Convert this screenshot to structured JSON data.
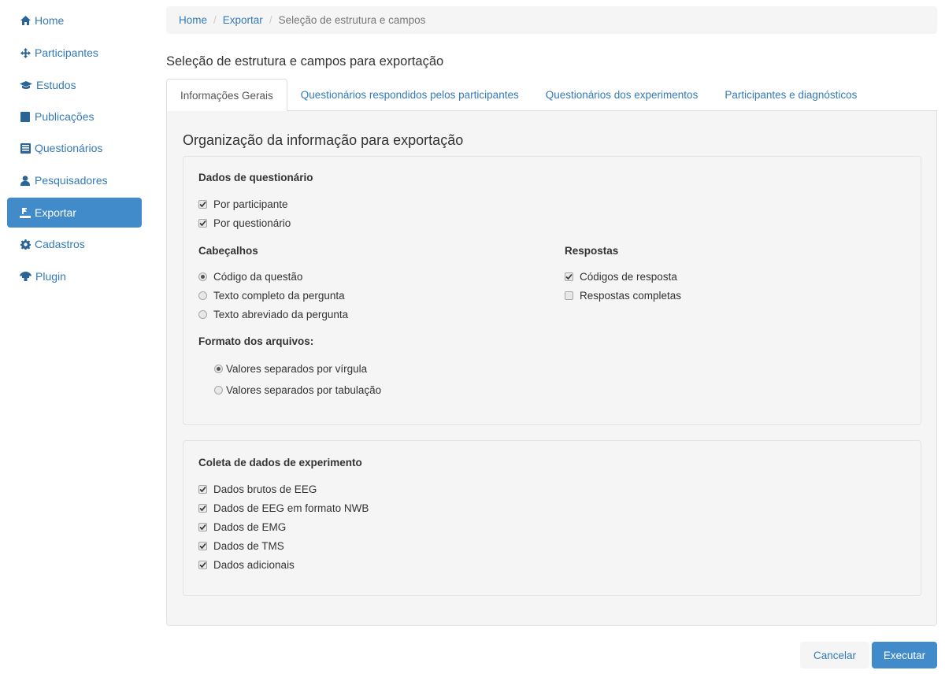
{
  "sidebar": {
    "items": [
      {
        "label": "Home",
        "icon": "home-icon",
        "active": false
      },
      {
        "label": "Participantes",
        "icon": "move-icon",
        "active": false
      },
      {
        "label": "Estudos",
        "icon": "graduation-cap-icon",
        "active": false
      },
      {
        "label": "Publicações",
        "icon": "book-icon",
        "active": false
      },
      {
        "label": "Questionários",
        "icon": "list-alt-icon",
        "active": false
      },
      {
        "label": "Pesquisadores",
        "icon": "user-icon",
        "active": false
      },
      {
        "label": "Exportar",
        "icon": "export-icon",
        "active": true
      },
      {
        "label": "Cadastros",
        "icon": "gear-icon",
        "active": false
      },
      {
        "label": "Plugin",
        "icon": "plugin-icon",
        "active": false
      }
    ]
  },
  "breadcrumb": {
    "home": "Home",
    "exportar": "Exportar",
    "current": "Seleção de estrutura e campos",
    "separator": "/"
  },
  "page_title": "Seleção de estrutura e campos para exportação",
  "tabs": [
    {
      "label": "Informações Gerais",
      "active": true
    },
    {
      "label": "Questionários respondidos pelos participantes",
      "active": false
    },
    {
      "label": "Questionários dos experimentos",
      "active": false
    },
    {
      "label": "Participantes e diagnósticos",
      "active": false
    }
  ],
  "section_title": "Organização da informação para exportação",
  "questionnaire": {
    "title": "Dados de questionário",
    "options": [
      {
        "label": "Por participante",
        "checked": true
      },
      {
        "label": "Por questionário",
        "checked": true
      }
    ]
  },
  "headers": {
    "title": "Cabeçalhos",
    "options": [
      {
        "label": "Código da questão",
        "checked": true
      },
      {
        "label": "Texto completo da pergunta",
        "checked": false
      },
      {
        "label": "Texto abreviado da pergunta",
        "checked": false
      }
    ]
  },
  "answers": {
    "title": "Respostas",
    "options": [
      {
        "label": "Códigos de resposta",
        "checked": true
      },
      {
        "label": "Respostas completas",
        "checked": false
      }
    ]
  },
  "file_format": {
    "title": "Formato dos arquivos:",
    "options": [
      {
        "label": "Valores separados por vírgula",
        "checked": true
      },
      {
        "label": "Valores separados por tabulação",
        "checked": false
      }
    ]
  },
  "experiment": {
    "title": "Coleta de dados de experimento",
    "options": [
      {
        "label": "Dados brutos de EEG",
        "checked": true
      },
      {
        "label": "Dados de EEG em formato NWB",
        "checked": true
      },
      {
        "label": "Dados de EMG",
        "checked": true
      },
      {
        "label": "Dados de TMS",
        "checked": true
      },
      {
        "label": "Dados adicionais",
        "checked": true
      }
    ]
  },
  "buttons": {
    "cancel": "Cancelar",
    "execute": "Executar"
  },
  "colors": {
    "link": "#337ab7",
    "active_bg": "#428bca",
    "panel_bg": "#f5f5f5"
  }
}
